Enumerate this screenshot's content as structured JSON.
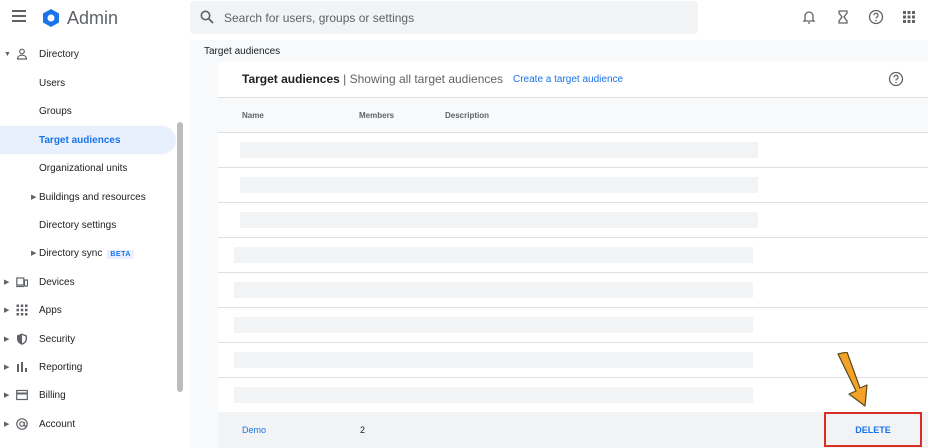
{
  "header": {
    "app_title": "Admin",
    "search_placeholder": "Search for users, groups or settings"
  },
  "sidebar": {
    "items": [
      {
        "label": "Directory"
      },
      {
        "label": "Users"
      },
      {
        "label": "Groups"
      },
      {
        "label": "Target audiences"
      },
      {
        "label": "Organizational units"
      },
      {
        "label": "Buildings and resources"
      },
      {
        "label": "Directory settings"
      },
      {
        "label": "Directory sync",
        "badge": "BETA"
      },
      {
        "label": "Devices"
      },
      {
        "label": "Apps"
      },
      {
        "label": "Security"
      },
      {
        "label": "Reporting"
      },
      {
        "label": "Billing"
      },
      {
        "label": "Account"
      }
    ]
  },
  "main": {
    "breadcrumb": "Target audiences",
    "card": {
      "title": "Target audiences",
      "separator": " | ",
      "subtitle": "Showing all target audiences",
      "create_link": "Create a target audience"
    },
    "table": {
      "columns": [
        "Name",
        "Members",
        "Description"
      ],
      "rows": [
        {
          "name": "Demo",
          "members": "2",
          "action": "DELETE"
        }
      ]
    }
  },
  "colors": {
    "accent": "#1a73e8",
    "highlight_border": "#d93025",
    "annotation_arrow": "#f4a12a"
  }
}
